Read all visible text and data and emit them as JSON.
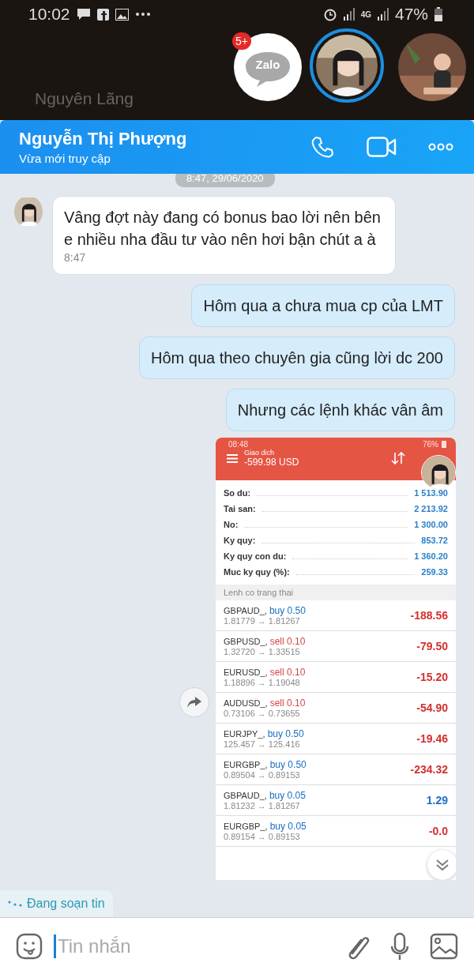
{
  "status_bar": {
    "time": "10:02",
    "network": "4G",
    "battery": "47%"
  },
  "chat_heads": {
    "behind_name": "Nguyên Lãng",
    "badge": "5+",
    "app_label": "Zalo"
  },
  "header": {
    "name": "Nguyễn Thị Phượng",
    "status": "Vừa mới truy cập"
  },
  "date_divider": "8:47, 29/06/2020",
  "messages": [
    {
      "kind": "incoming",
      "text": "Vâng đợt này đang có bonus bao lời nên bên e nhiều nha đầu tư vào nên hơi bận chút a à",
      "time": "8:47"
    },
    {
      "kind": "outgoing",
      "text": "Hôm qua a chưa mua cp của LMT"
    },
    {
      "kind": "outgoing",
      "text": "Hôm qua theo chuyên gia cũng lời dc 200"
    },
    {
      "kind": "outgoing",
      "text": "Nhưng các lệnh khác vân âm"
    }
  ],
  "shared_screenshot": {
    "time": "08:48",
    "battery": "76%",
    "title": "Giao dich",
    "balance": "-599.98 USD",
    "account": [
      {
        "label": "So du:",
        "value": "1 513.90"
      },
      {
        "label": "Tai san:",
        "value": "2 213.92"
      },
      {
        "label": "No:",
        "value": "1 300.00"
      },
      {
        "label": "Ky quy:",
        "value": "853.72"
      },
      {
        "label": "Ky quy con du:",
        "value": "1 360.20"
      },
      {
        "label": "Muc ky quy (%):",
        "value": "259.33"
      }
    ],
    "section": "Lenh co trang thai",
    "orders": [
      {
        "symbol": "GBPAUD_,",
        "order": {
          "text": "buy 0.50",
          "color": "#1a6fc0"
        },
        "prices": "1.81779 → 1.81267",
        "profit": {
          "text": "-188.56",
          "color": "#d32f2f"
        }
      },
      {
        "symbol": "GBPUSD_,",
        "order": {
          "text": "sell 0.10",
          "color": "#d64545"
        },
        "prices": "1.32720 → 1.33515",
        "profit": {
          "text": "-79.50",
          "color": "#d32f2f"
        }
      },
      {
        "symbol": "EURUSD_,",
        "order": {
          "text": "sell 0.10",
          "color": "#d64545"
        },
        "prices": "1.18896 → 1.19048",
        "profit": {
          "text": "-15.20",
          "color": "#d32f2f"
        }
      },
      {
        "symbol": "AUDUSD_,",
        "order": {
          "text": "sell 0.10",
          "color": "#d64545"
        },
        "prices": "0.73106 → 0.73655",
        "profit": {
          "text": "-54.90",
          "color": "#d32f2f"
        }
      },
      {
        "symbol": "EURJPY_,",
        "order": {
          "text": "buy 0.50",
          "color": "#1a6fc0"
        },
        "prices": "125.457 → 125.416",
        "profit": {
          "text": "-19.46",
          "color": "#d32f2f"
        }
      },
      {
        "symbol": "EURGBP_,",
        "order": {
          "text": "buy 0.50",
          "color": "#1a6fc0"
        },
        "prices": "0.89504 → 0.89153",
        "profit": {
          "text": "-234.32",
          "color": "#d32f2f"
        }
      },
      {
        "symbol": "GBPAUD_,",
        "order": {
          "text": "buy 0.05",
          "color": "#1a6fc0"
        },
        "prices": "1.81232 → 1.81267",
        "profit": {
          "text": "1.29",
          "color": "#1f6fc0"
        }
      },
      {
        "symbol": "EURGBP_,",
        "order": {
          "text": "buy 0.05",
          "color": "#1a6fc0"
        },
        "prices": "0.89154 → 0.89153",
        "profit": {
          "text": "-0.0",
          "color": "#d32f2f"
        }
      }
    ]
  },
  "typing_indicator": "Đang soạn tin",
  "composer": {
    "placeholder": "Tin nhắn"
  }
}
